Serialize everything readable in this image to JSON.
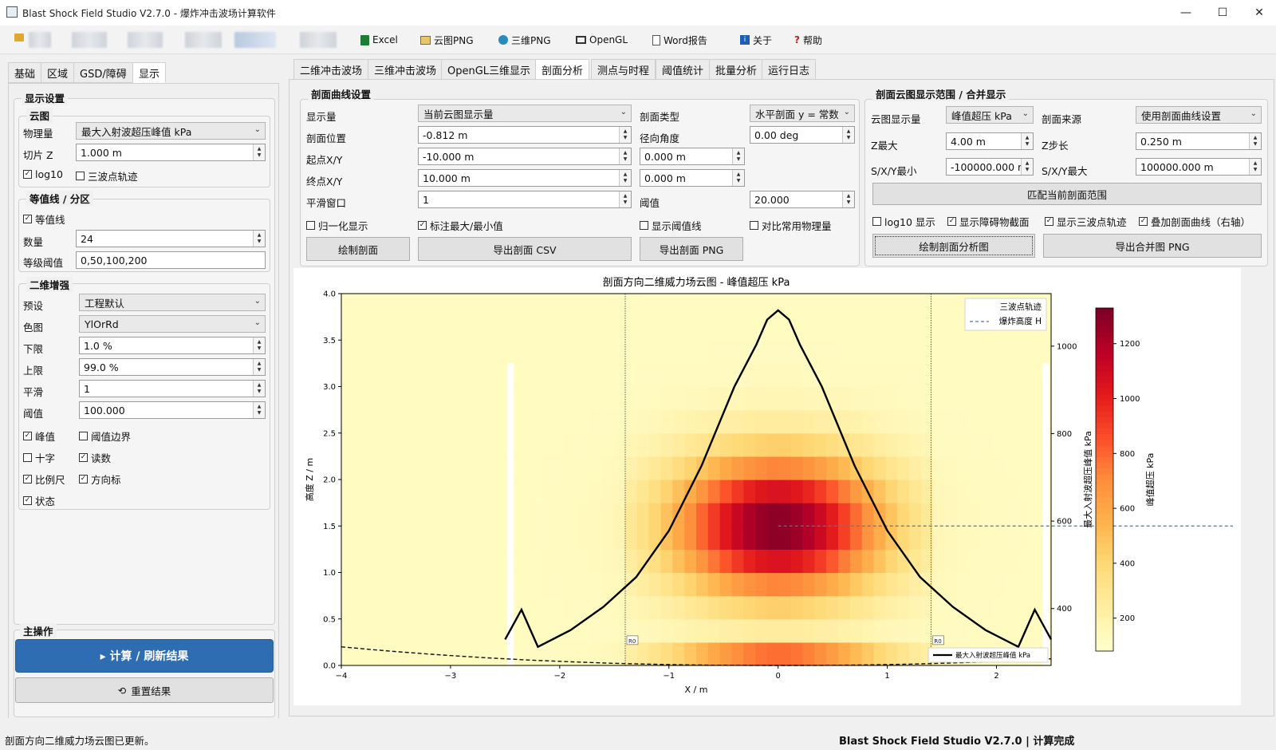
{
  "window": {
    "title": "Blast Shock Field Studio V2.7.0 - 爆炸冲击波场计算软件",
    "minimize": "—",
    "maximize": "☐",
    "close": "✕"
  },
  "toolbar": {
    "items": [
      {
        "label": "Excel",
        "icon": "excel-icon",
        "color": "#1e7d34"
      },
      {
        "label": "云图PNG",
        "icon": "image-icon",
        "color": "#c08a2a"
      },
      {
        "label": "三维PNG",
        "icon": "globe-icon",
        "color": "#2a8ac0"
      },
      {
        "label": "OpenGL",
        "icon": "monitor-icon",
        "color": "#333333"
      },
      {
        "label": "Word报告",
        "icon": "document-icon",
        "color": "#555555"
      },
      {
        "label": "关于",
        "icon": "info-icon",
        "color": "#1e5fb4"
      },
      {
        "label": "帮助",
        "icon": "question-icon",
        "color": "#c02020"
      }
    ]
  },
  "left_tabs": [
    "基础",
    "区域",
    "GSD/障碍",
    "显示"
  ],
  "left": {
    "display_settings": "显示设置",
    "cloud": {
      "title": "云图",
      "qty_label": "物理量",
      "qty_value": "最大入射波超压峰值 kPa",
      "slice_label": "切片 Z",
      "slice_value": "1.000 m",
      "log10": "log10",
      "tri_track": "三波点轨迹"
    },
    "contour": {
      "title": "等值线 / 分区",
      "enable": "等值线",
      "count_label": "数量",
      "count_value": "24",
      "levels_label": "等级阈值",
      "levels_value": "0,50,100,200"
    },
    "enhance": {
      "title": "二维增强",
      "preset_label": "预设",
      "preset_value": "工程默认",
      "cmap_label": "色图",
      "cmap_value": "YlOrRd",
      "low_label": "下限",
      "low_value": "1.0 %",
      "high_label": "上限",
      "high_value": "99.0 %",
      "smooth_label": "平滑",
      "smooth_value": "1",
      "thr_label": "阈值",
      "thr_value": "100.000",
      "checks": {
        "peak": "峰值",
        "thr_edge": "阈值边界",
        "cross": "十字",
        "readout": "读数",
        "scale": "比例尺",
        "compass": "方向标",
        "status": "状态"
      }
    },
    "main_ops": {
      "title": "主操作",
      "compute": "▸  计算 / 刷新结果",
      "reset": "重置结果"
    }
  },
  "right_tabs": [
    "二维冲击波场",
    "三维冲击波场",
    "OpenGL三维显示",
    "剖面分析",
    "测点与时程",
    "阈值统计",
    "批量分析",
    "运行日志"
  ],
  "profile": {
    "title": "剖面曲线设置",
    "disp_label": "显示量",
    "disp_value": "当前云图显示量",
    "type_label": "剖面类型",
    "type_value": "水平剖面 y = 常数",
    "pos_label": "剖面位置",
    "pos_value": "-0.812 m",
    "angle_label": "径向角度",
    "angle_value": "0.00 deg",
    "start_label": "起点X/Y",
    "start_x": "-10.000 m",
    "start_y": "0.000 m",
    "end_label": "终点X/Y",
    "end_x": "10.000 m",
    "end_y": "0.000 m",
    "smooth_label": "平滑窗口",
    "smooth_value": "1",
    "thr_label": "阈值",
    "thr_value": "20.000",
    "normalize": "归一化显示",
    "mark_minmax": "标注最大/最小值",
    "show_thr": "显示阈值线",
    "compare": "对比常用物理量",
    "draw_btn": "绘制剖面",
    "csv_btn": "导出剖面 CSV",
    "png_btn": "导出剖面 PNG"
  },
  "range": {
    "title": "剖面云图显示范围 / 合并显示",
    "qty_label": "云图显示量",
    "qty_value": "峰值超压 kPa",
    "src_label": "剖面来源",
    "src_value": "使用剖面曲线设置",
    "zmax_label": "Z最大",
    "zmax_value": "4.00 m",
    "zstep_label": "Z步长",
    "zstep_value": "0.250 m",
    "smin_label": "S/X/Y最小",
    "smin_value": "-100000.000 m",
    "smax_label": "S/X/Y最大",
    "smax_value": "100000.000 m",
    "match_btn": "匹配当前剖面范围",
    "log10": "log10 显示",
    "show_obstacle": "显示障碍物截面",
    "show_tri": "显示三波点轨迹",
    "overlay": "叠加剖面曲线（右轴）",
    "draw_btn": "绘制剖面分析图",
    "export_btn": "导出合并图 PNG"
  },
  "chart_data": {
    "type": "heatmap",
    "title": "剖面方向二维威力场云图 - 峰值超压 kPa",
    "xlabel": "X / m",
    "ylabel": "高度 Z / m",
    "y2label": "最大入射波超压峰值 kPa",
    "cbar_label": "峰值超压 kPa",
    "colormap": "YlOrRd",
    "xlim": [
      -4,
      2.5
    ],
    "ylim": [
      0,
      4
    ],
    "xticks": [
      -4,
      -3,
      -2,
      -1,
      0,
      1,
      2
    ],
    "yticks": [
      0.0,
      0.5,
      1.0,
      1.5,
      2.0,
      2.5,
      3.0,
      3.5,
      4.0
    ],
    "y2lim": [
      270,
      1120
    ],
    "y2ticks": [
      400,
      600,
      800,
      1000
    ],
    "cbar_ticks": [
      200,
      400,
      600,
      800,
      1000,
      1200
    ],
    "cbar_range": [
      80,
      1330
    ],
    "legend": [
      "三波点轨迹",
      "爆炸高度 H"
    ],
    "legend2": "最大入射波超压峰值 kPa",
    "r0_label": "R0",
    "r0_x": [
      -1.4,
      1.4
    ],
    "obstacle_x": [
      -2.45,
      2.45
    ],
    "burst_height": 1.5,
    "curve": {
      "x": [
        -2.5,
        -2.35,
        -2.2,
        -1.9,
        -1.6,
        -1.3,
        -1.0,
        -0.7,
        -0.4,
        -0.2,
        -0.1,
        0.0,
        0.1,
        0.2,
        0.4,
        0.7,
        1.0,
        1.3,
        1.6,
        1.9,
        2.2,
        2.35,
        2.5
      ],
      "y": [
        0.28,
        0.6,
        0.2,
        0.38,
        0.63,
        0.95,
        1.45,
        2.15,
        3.0,
        3.45,
        3.72,
        3.82,
        3.72,
        3.45,
        3.0,
        2.15,
        1.45,
        0.95,
        0.63,
        0.38,
        0.2,
        0.6,
        0.28
      ]
    }
  },
  "status": {
    "message": "剖面方向二维威力场云图已更新。",
    "right": "Blast Shock Field Studio V2.7.0 | 计算完成"
  }
}
